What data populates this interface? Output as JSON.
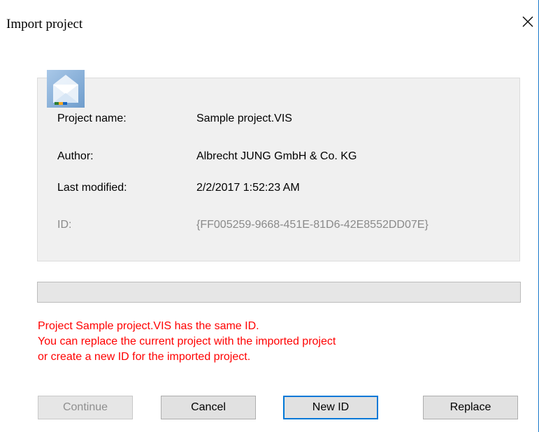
{
  "dialog": {
    "title": "Import project",
    "close_icon": "close-icon"
  },
  "project": {
    "icon": "project-file-icon",
    "fields": [
      {
        "label": "Project name:",
        "value": "Sample project.VIS"
      },
      {
        "label": "Author:",
        "value": "Albrecht JUNG GmbH & Co. KG"
      },
      {
        "label": "Last modified:",
        "value": "2/2/2017 1:52:23 AM"
      },
      {
        "label": "ID:",
        "value": "{FF005259-9668-451E-81D6-42E8552DD07E}"
      }
    ]
  },
  "progress": {
    "value": 0
  },
  "message": {
    "lines": [
      "Project Sample project.VIS has the same ID.",
      "You can replace the current project with the imported project",
      "or create a new ID for the imported project."
    ],
    "color": "#ff0000"
  },
  "buttons": {
    "continue": "Continue",
    "cancel": "Cancel",
    "new_id": "New ID",
    "replace": "Replace"
  },
  "colors": {
    "window_border": "#1979ca",
    "default_button_border": "#0078d7"
  }
}
